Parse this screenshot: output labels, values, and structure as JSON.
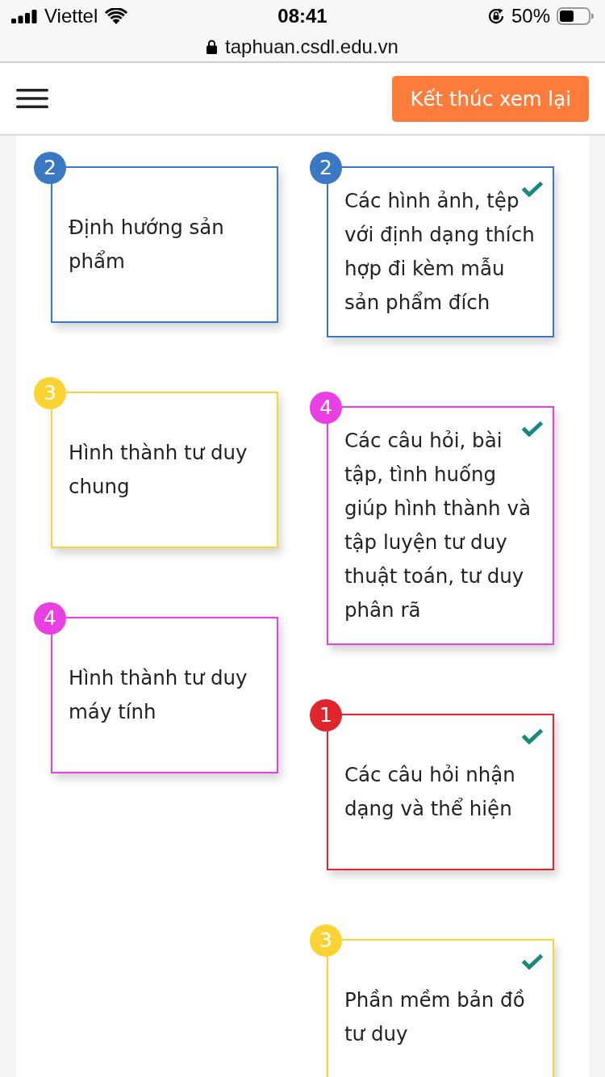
{
  "status_bar": {
    "carrier": "Viettel",
    "time": "08:41",
    "battery_text": "50%"
  },
  "address_bar": {
    "url": "taphuan.csdl.edu.vn"
  },
  "header": {
    "button": "Kết thúc xem lại"
  },
  "columns": [
    {
      "cards": [
        {
          "number": "2",
          "color": "#3b78c3",
          "text": "Định hướng sản phẩm",
          "correct": false
        },
        {
          "number": "3",
          "color": "#fbd335",
          "text": "Hình thành tư duy chung",
          "correct": false
        },
        {
          "number": "4",
          "color": "#e93fe3",
          "text": "Hình thành tư duy máy tính",
          "correct": false
        }
      ]
    },
    {
      "cards": [
        {
          "number": "2",
          "color": "#3b78c3",
          "text": "Các hình ảnh, tệp với định dạng thích hợp đi kèm mẫu sản phẩm đích",
          "correct": true
        },
        {
          "number": "4",
          "color": "#e93fe3",
          "text": "Các câu hỏi, bài tập, tình huống giúp hình thành và tập luyện tư duy thuật toán, tư duy phân rã",
          "correct": true
        },
        {
          "number": "1",
          "color": "#e0252c",
          "text": "Các câu hỏi nhận dạng và thể hiện",
          "correct": true
        },
        {
          "number": "3",
          "color": "#fbd335",
          "text": "Phần mềm bản đồ tư duy",
          "correct": true
        }
      ]
    }
  ]
}
